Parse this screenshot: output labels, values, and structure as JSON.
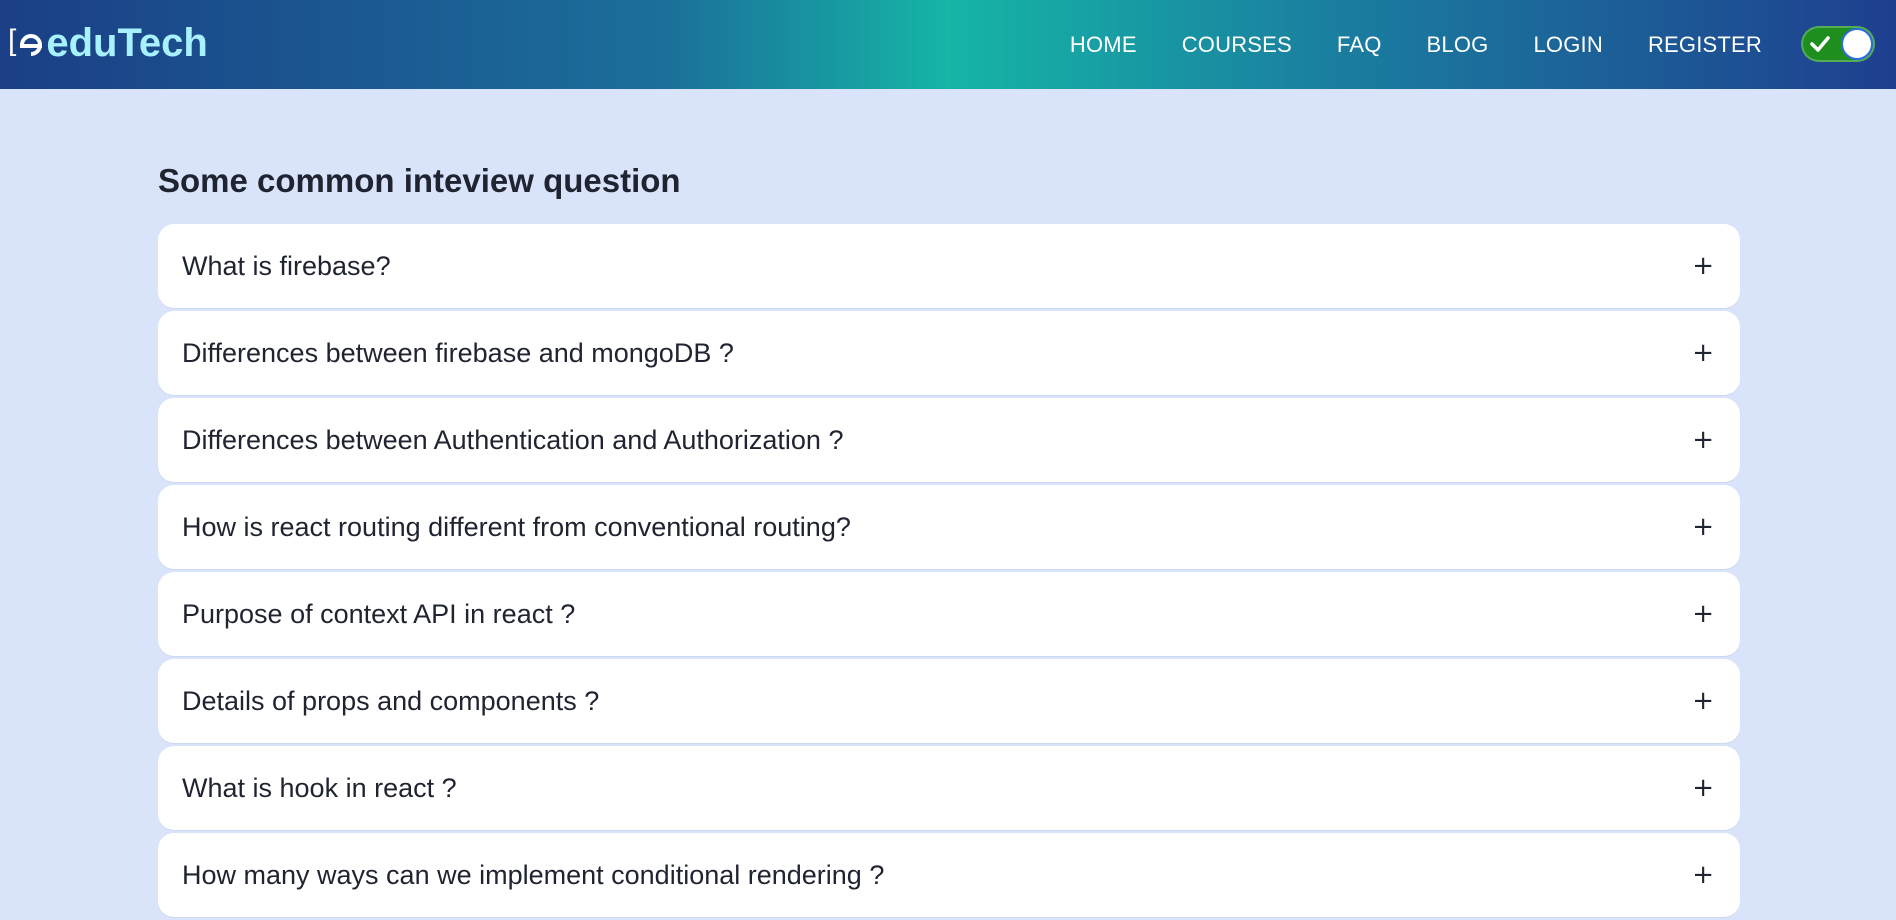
{
  "brand": {
    "bracket": "[",
    "name": "eduTech"
  },
  "nav": {
    "items": [
      {
        "label": "HOME"
      },
      {
        "label": "COURSES"
      },
      {
        "label": "FAQ"
      },
      {
        "label": "BLOG"
      },
      {
        "label": "LOGIN"
      },
      {
        "label": "REGISTER"
      }
    ]
  },
  "theme_toggle": {
    "state": "on",
    "icon": "check-icon",
    "color": "#1e8f1e"
  },
  "faq": {
    "title": "Some common inteview question",
    "expand_icon": "+",
    "items": [
      {
        "question": "What is firebase?"
      },
      {
        "question": "Differences between firebase and mongoDB ?"
      },
      {
        "question": "Differences between Authentication and Authorization ?"
      },
      {
        "question": "How is react routing different from conventional routing?"
      },
      {
        "question": "Purpose of context API in react ?"
      },
      {
        "question": "Details of props and components ?"
      },
      {
        "question": "What is hook in react ?"
      },
      {
        "question": "How many ways can we implement conditional rendering ?"
      }
    ]
  },
  "colors": {
    "background": "#d9e3fa",
    "nav_gradient_start": "#1b3f86",
    "nav_gradient_mid": "#16b5a6",
    "logo": "#a8f1ff",
    "card": "#ffffff",
    "text": "#1f2430"
  }
}
